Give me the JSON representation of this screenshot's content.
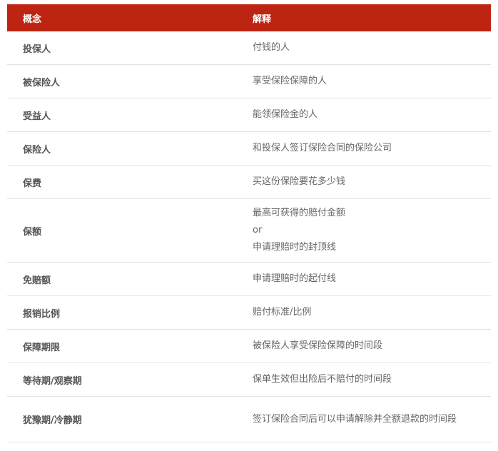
{
  "header": {
    "col1": "概念",
    "col2": "解释"
  },
  "rows": [
    {
      "term": "投保人",
      "desc": [
        "付钱的人"
      ]
    },
    {
      "term": "被保险人",
      "desc": [
        "享受保险保障的人"
      ]
    },
    {
      "term": "受益人",
      "desc": [
        "能领保险金的人"
      ]
    },
    {
      "term": "保险人",
      "desc": [
        "和投保人签订保险合同的保险公司"
      ]
    },
    {
      "term": "保费",
      "desc": [
        "买这份保险要花多少钱"
      ]
    },
    {
      "term": "保额",
      "desc": [
        "最高可获得的赔付金额",
        "or",
        "申请理赔时的封顶线"
      ]
    },
    {
      "term": "免赔额",
      "desc": [
        "申请理赔时的起付线"
      ]
    },
    {
      "term": "报销比例",
      "desc": [
        "赔付标准/比例"
      ]
    },
    {
      "term": "保障期限",
      "desc": [
        "被保险人享受保险保障的时间段"
      ]
    },
    {
      "term": "等待期/观察期",
      "desc": [
        "保单生效但出险后不赔付的时间段"
      ]
    },
    {
      "term": "犹豫期/冷静期",
      "desc": [
        "签订保险合同后可以申请解除并全额退款的时间段"
      ]
    }
  ]
}
